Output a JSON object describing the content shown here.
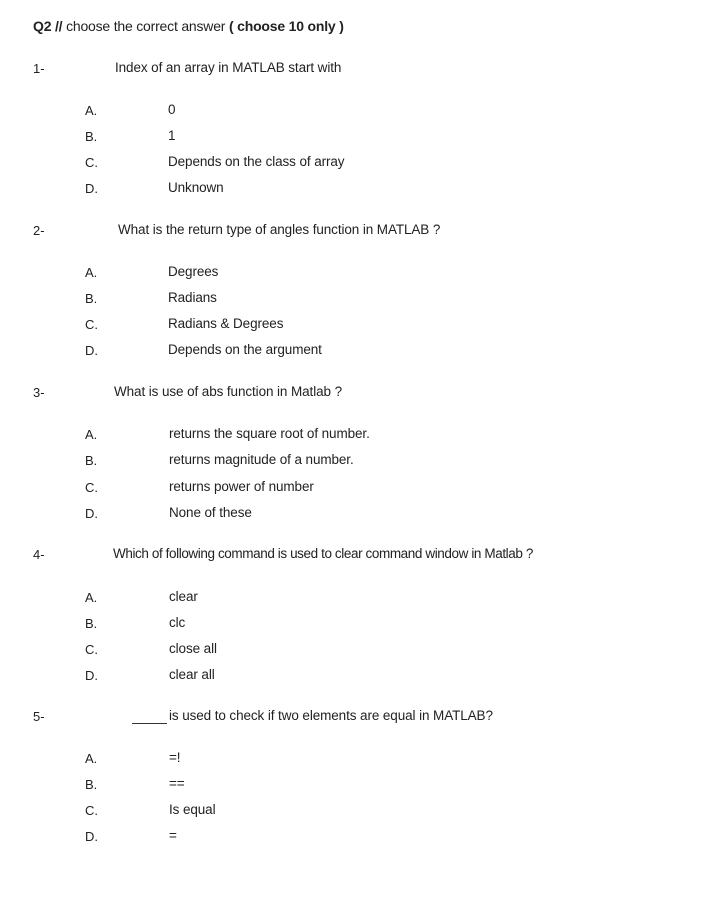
{
  "header": {
    "prefix": "Q2 //",
    "text": "choose the correct answer",
    "paren_open": "(",
    "highlight": "choose 10 only",
    "paren_close": ")"
  },
  "questions": [
    {
      "number": "1-",
      "text": "Index of an array in MATLAB start with",
      "options": [
        {
          "label": "A.",
          "text": "0"
        },
        {
          "label": "B.",
          "text": "1"
        },
        {
          "label": "C.",
          "text": "Depends on the class of array"
        },
        {
          "label": "D.",
          "text": "Unknown"
        }
      ]
    },
    {
      "number": "2-",
      "text": "What is the return type of angles function in MATLAB ?",
      "options": [
        {
          "label": "A.",
          "text": "Degrees"
        },
        {
          "label": "B.",
          "text": "Radians"
        },
        {
          "label": "C.",
          "text": "Radians & Degrees"
        },
        {
          "label": "D.",
          "text": "Depends on the argument"
        }
      ]
    },
    {
      "number": "3-",
      "text": "What is use of abs function in Matlab ?",
      "options": [
        {
          "label": "A.",
          "text": "returns the square root of number."
        },
        {
          "label": "B.",
          "text": "returns magnitude of a number."
        },
        {
          "label": "C.",
          "text": "returns power of number"
        },
        {
          "label": "D.",
          "text": "None of these"
        }
      ]
    },
    {
      "number": "4-",
      "text": "Which of following command is used to clear command window in Matlab ?",
      "options": [
        {
          "label": "A.",
          "text": "clear"
        },
        {
          "label": "B.",
          "text": "clc"
        },
        {
          "label": "C.",
          "text": "close all"
        },
        {
          "label": "D.",
          "text": "clear all"
        }
      ]
    },
    {
      "number": "5-",
      "text": "is used to check if two elements are equal in MATLAB?",
      "options": [
        {
          "label": "A.",
          "text": "=!"
        },
        {
          "label": "B.",
          "text": "=="
        },
        {
          "label": "C.",
          "text": "Is equal"
        },
        {
          "label": "D.",
          "text": "="
        }
      ]
    }
  ]
}
